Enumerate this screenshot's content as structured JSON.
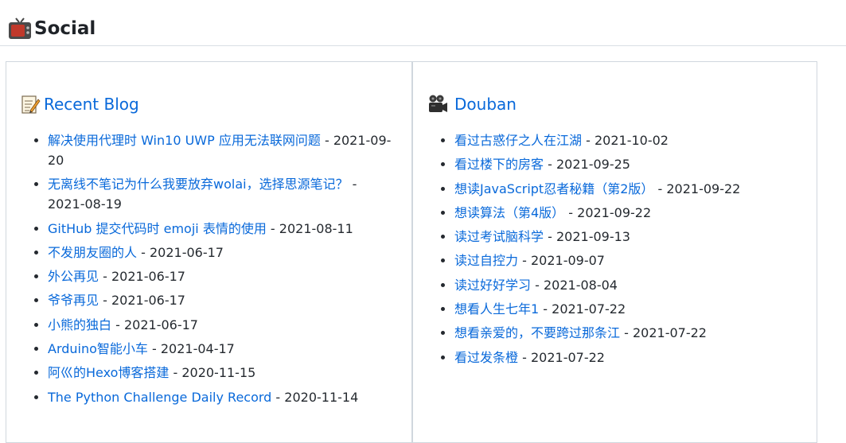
{
  "section": {
    "title": "Social",
    "icon": "tv-icon"
  },
  "blog": {
    "title": "Recent Blog",
    "icon": "memo-icon",
    "items": [
      {
        "title": "解决使用代理时 Win10 UWP 应用无法联网问题",
        "date": "2021-09-20"
      },
      {
        "title": "无离线不笔记为什么我要放弃wolai，选择思源笔记？",
        "date": "2021-08-19"
      },
      {
        "title": "GitHub 提交代码时 emoji 表情的使用",
        "date": "2021-08-11"
      },
      {
        "title": "不发朋友圈的人",
        "date": "2021-06-17"
      },
      {
        "title": "外公再见",
        "date": "2021-06-17"
      },
      {
        "title": "爷爷再见",
        "date": "2021-06-17"
      },
      {
        "title": "小熊的独白",
        "date": "2021-06-17"
      },
      {
        "title": "Arduino智能小车",
        "date": "2021-04-17"
      },
      {
        "title": "阿巛的Hexo博客搭建",
        "date": "2020-11-15"
      },
      {
        "title": "The Python Challenge Daily Record",
        "date": "2020-11-14"
      }
    ]
  },
  "douban": {
    "title": "Douban",
    "icon": "movie-camera-icon",
    "items": [
      {
        "title": "看过古惑仔之人在江湖",
        "date": "2021-10-02"
      },
      {
        "title": "看过楼下的房客",
        "date": "2021-09-25"
      },
      {
        "title": "想读JavaScript忍者秘籍（第2版）",
        "date": "2021-09-22"
      },
      {
        "title": "想读算法（第4版）",
        "date": "2021-09-22"
      },
      {
        "title": "读过考试脑科学",
        "date": "2021-09-13"
      },
      {
        "title": "读过自控力",
        "date": "2021-09-07"
      },
      {
        "title": "读过好好学习",
        "date": "2021-08-04"
      },
      {
        "title": "想看人生七年1",
        "date": "2021-07-22"
      },
      {
        "title": "想看亲爱的，不要跨过那条江",
        "date": "2021-07-22"
      },
      {
        "title": "看过发条橙",
        "date": "2021-07-22"
      }
    ]
  },
  "separator": " - ",
  "colors": {
    "link": "#0969da",
    "text": "#24292f",
    "border": "#d0d7de"
  }
}
